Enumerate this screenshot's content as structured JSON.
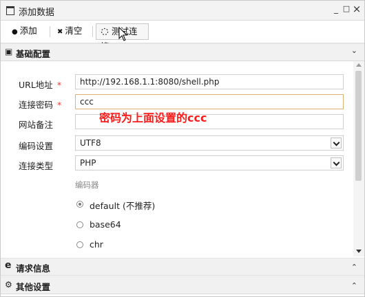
{
  "window": {
    "title": "添加数据",
    "minimize": "_",
    "maximize": "□",
    "close": "×"
  },
  "toolbar": {
    "add_icon": "●",
    "add_label": "添加",
    "clear_icon": "✖",
    "clear_label": "清空",
    "test_label": "测试连接"
  },
  "sections": {
    "basic": {
      "title": "基础配置",
      "icon": "▣"
    },
    "request": {
      "title": "请求信息",
      "icon": "e"
    },
    "other": {
      "title": "其他设置",
      "icon": "⚙"
    }
  },
  "form": {
    "url": {
      "label": "URL地址",
      "required_mark": "*",
      "value": "http://192.168.1.1:8080/shell.php"
    },
    "password": {
      "label": "连接密码",
      "required_mark": "*",
      "value": "ccc"
    },
    "note": {
      "label": "网站备注",
      "value": ""
    },
    "encoding": {
      "label": "编码设置",
      "value": "UTF8"
    },
    "type": {
      "label": "连接类型",
      "value": "PHP"
    },
    "encoder": {
      "group_label": "编码器",
      "options": [
        {
          "label": "default (不推荐)",
          "checked": true
        },
        {
          "label": "base64",
          "checked": false
        },
        {
          "label": "chr",
          "checked": false
        }
      ]
    }
  },
  "annotation": "密码为上面设置的ccc",
  "colors": {
    "required": "#ee3333",
    "annotation": "#ff1a1a",
    "focus_border": "#e0b070"
  }
}
